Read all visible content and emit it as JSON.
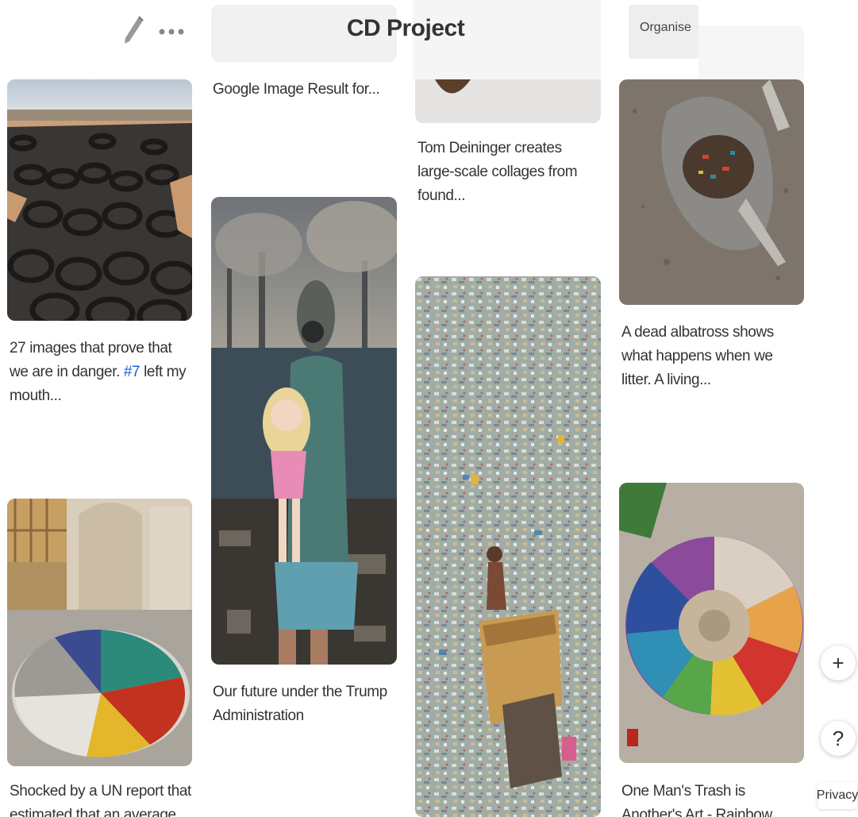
{
  "board": {
    "title": "CD Project",
    "organise_label": "Organise",
    "edit_icon": "pencil-icon",
    "more_icon": "more-horizontal-icon"
  },
  "pins": [
    {
      "caption_pre": "27 images that prove that we are in danger. ",
      "caption_hash": "#7",
      "caption_post": " left my mouth...",
      "image": "tire-field-photo"
    },
    {
      "caption": "Shocked by a UN report that estimated that an average",
      "image": "warehouse-waste-circle-photo"
    },
    {
      "caption": "Google Image Result for...",
      "image": "none"
    },
    {
      "caption": "Our future under the Trump Administration",
      "image": "gas-mask-child-photo"
    },
    {
      "caption": "Tom Deininger creates large-scale collages from found...",
      "image": "collage-photo"
    },
    {
      "caption": "",
      "image": "plastic-river-photo"
    },
    {
      "caption": "A dead albatross shows what happens when we litter. A living...",
      "image": "albatross-photo"
    },
    {
      "caption": "One Man's Trash is Another's Art - Rainbow Marine Life",
      "image": "rainbow-trash-mandala-photo"
    }
  ],
  "fab": {
    "add_label": "+",
    "help_label": "?"
  },
  "footer": {
    "privacy_label": "Privacy"
  },
  "colors": {
    "hashtag": "#1f5fd6",
    "text": "#333333",
    "background": "#ffffff"
  }
}
